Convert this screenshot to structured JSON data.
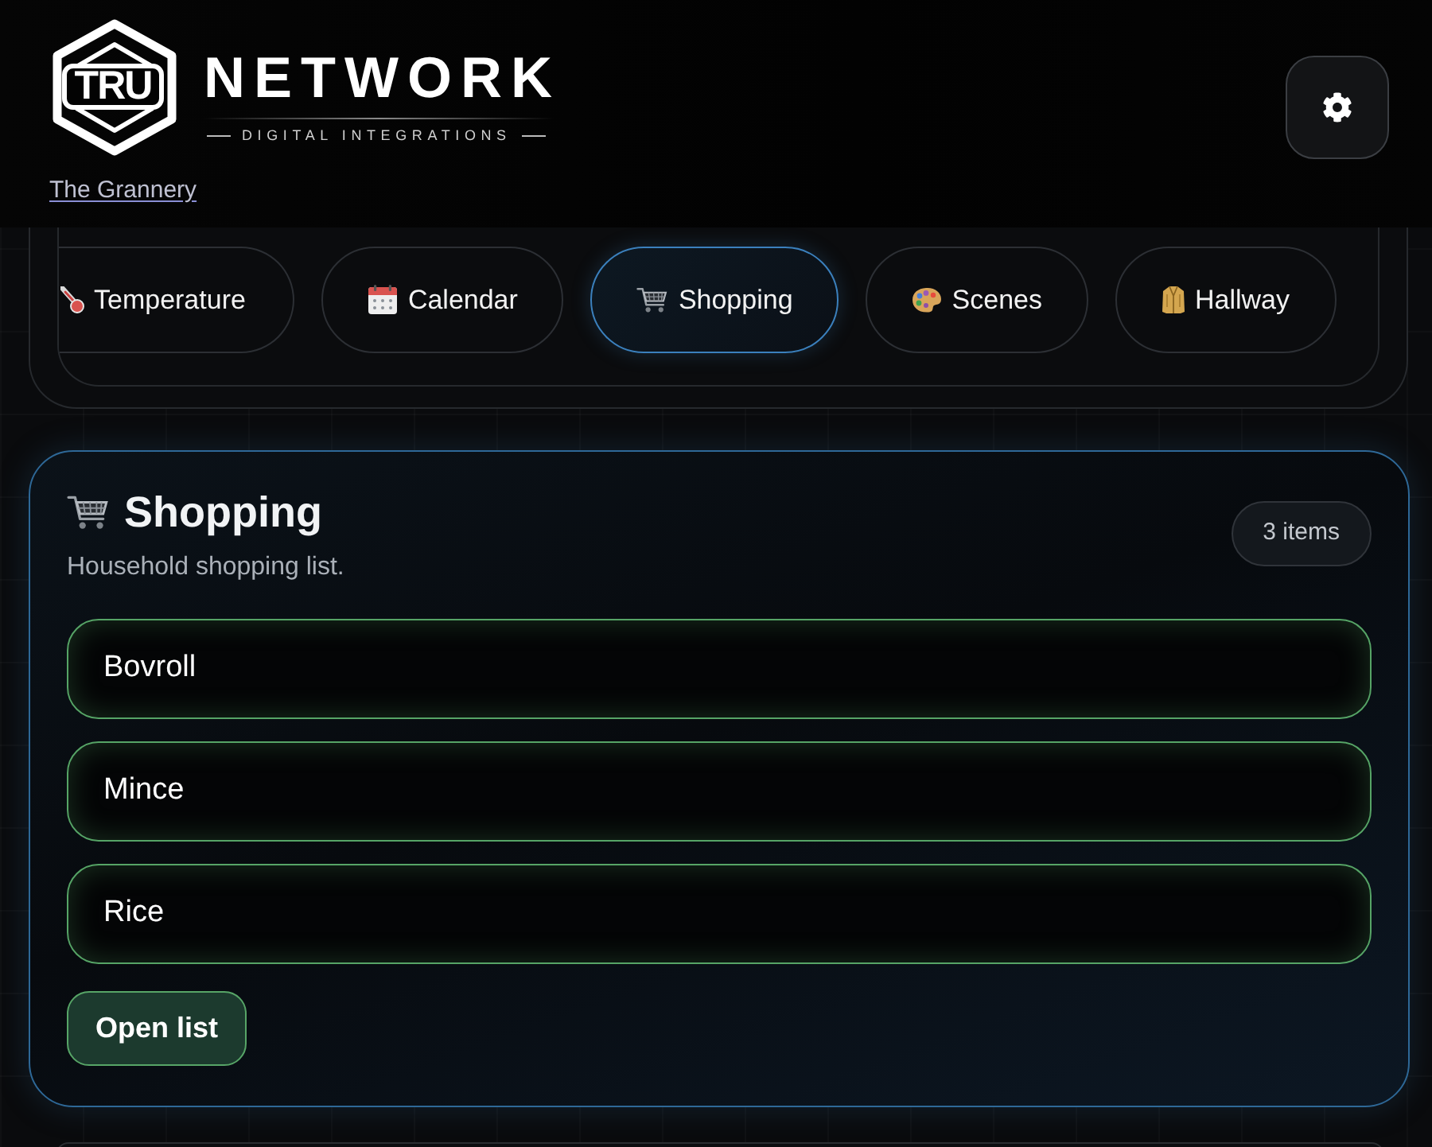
{
  "header": {
    "logo": {
      "badge": "TRU",
      "wordmark": "NETWORK",
      "tagline": "DIGITAL INTEGRATIONS"
    },
    "location_link": "The Grannery"
  },
  "tabs": [
    {
      "label": "Temperature",
      "kind": "temperature",
      "selected": false
    },
    {
      "label": "Calendar",
      "kind": "calendar",
      "selected": false
    },
    {
      "label": "Shopping",
      "kind": "shopping",
      "selected": true
    },
    {
      "label": "Scenes",
      "kind": "scenes",
      "selected": false
    },
    {
      "label": "Hallway",
      "kind": "hallway",
      "selected": false
    }
  ],
  "card": {
    "title": "Shopping",
    "subtitle": "Household shopping list.",
    "count_badge": "3 items",
    "items": [
      "Bovroll",
      "Mince",
      "Rice"
    ],
    "button": "Open list"
  }
}
